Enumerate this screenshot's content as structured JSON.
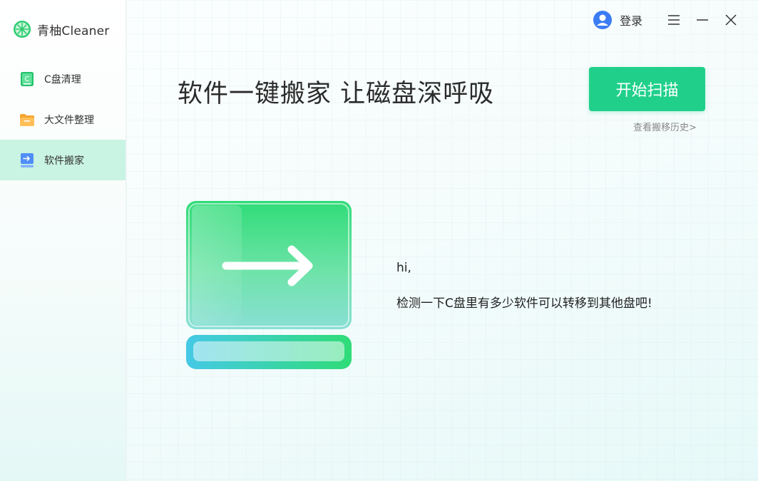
{
  "app": {
    "name": "青柚Cleaner"
  },
  "sidebar": {
    "items": [
      {
        "label": "C盘清理",
        "icon": "disk-clean-icon",
        "active": false
      },
      {
        "label": "大文件整理",
        "icon": "folder-icon",
        "active": false
      },
      {
        "label": "软件搬家",
        "icon": "software-move-icon",
        "active": true
      }
    ]
  },
  "topbar": {
    "login_label": "登录",
    "user_icon": "user-avatar-icon",
    "menu_icon": "hamburger-icon",
    "minimize_icon": "minimize-icon",
    "close_icon": "close-icon"
  },
  "main": {
    "headline": "软件一键搬家 让磁盘深呼吸",
    "scan_button": "开始扫描",
    "history_link": "查看搬移历史>",
    "greeting": "hi,",
    "description": "检测一下C盘里有多少软件可以转移到其他盘吧!",
    "illustration_icon": "migration-arrow-illustration"
  },
  "colors": {
    "accent": "#20d08a",
    "active_nav_bg": "#c9f3e3",
    "text": "#222222"
  }
}
